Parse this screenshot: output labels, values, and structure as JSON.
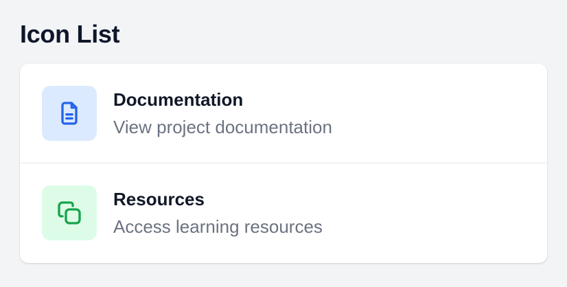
{
  "header": {
    "title": "Icon List"
  },
  "items": [
    {
      "title": "Documentation",
      "description": "View project documentation",
      "icon": "document-icon",
      "icon_color": "#2563eb",
      "icon_bg": "#dbeafe"
    },
    {
      "title": "Resources",
      "description": "Access learning resources",
      "icon": "copy-icon",
      "icon_color": "#16a34a",
      "icon_bg": "#dcfce7"
    }
  ]
}
